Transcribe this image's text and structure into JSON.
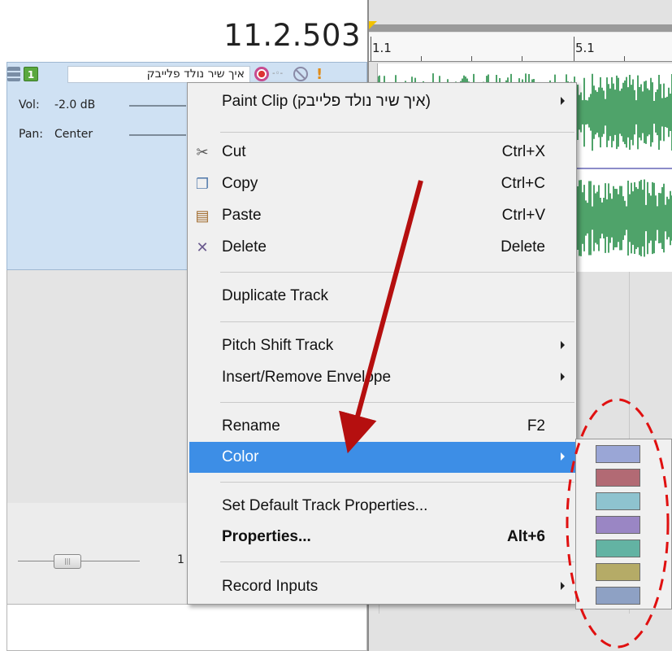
{
  "time_display": "11.2.503",
  "track": {
    "number": "1",
    "name": "איך שיר נולד פלייבק",
    "vol_label": "Vol:",
    "vol_value": "-2.0 dB",
    "pan_label": "Pan:",
    "pan_value": "Center"
  },
  "bottom": {
    "readout": "1"
  },
  "ruler": {
    "labels": [
      "1.1",
      "5.1"
    ]
  },
  "menu": {
    "items": [
      {
        "label": "Paint Clip (איך שיר נולד פלייבק)",
        "shortcut": "",
        "submenu": true
      },
      {
        "label": "Cut",
        "shortcut": "Ctrl+X",
        "icon": "scissors-icon"
      },
      {
        "label": "Copy",
        "shortcut": "Ctrl+C",
        "icon": "copy-icon"
      },
      {
        "label": "Paste",
        "shortcut": "Ctrl+V",
        "icon": "paste-icon"
      },
      {
        "label": "Delete",
        "shortcut": "Delete",
        "icon": "delete-x-icon"
      },
      {
        "label": "Duplicate Track",
        "shortcut": ""
      },
      {
        "label": "Pitch Shift Track",
        "shortcut": "",
        "submenu": true
      },
      {
        "label": "Insert/Remove Envelope",
        "shortcut": "",
        "submenu": true
      },
      {
        "label": "Rename",
        "shortcut": "F2"
      },
      {
        "label": "Color",
        "shortcut": "",
        "submenu": true,
        "selected": true
      },
      {
        "label": "Set Default Track Properties...",
        "shortcut": ""
      },
      {
        "label": "Properties...",
        "shortcut": "Alt+6",
        "bold": true
      },
      {
        "label": "Record Inputs",
        "shortcut": "",
        "submenu": true
      }
    ]
  },
  "color_swatches": [
    "#9aa6d6",
    "#b26a74",
    "#8ec3cf",
    "#9a86c4",
    "#63b3a3",
    "#b5ab67",
    "#8ea1c4"
  ],
  "colors": {
    "waveform": "#4fa36a",
    "selection": "#3d8ee6",
    "annotation_arrow": "#b50f0f",
    "annotation_circle": "#e01010"
  }
}
